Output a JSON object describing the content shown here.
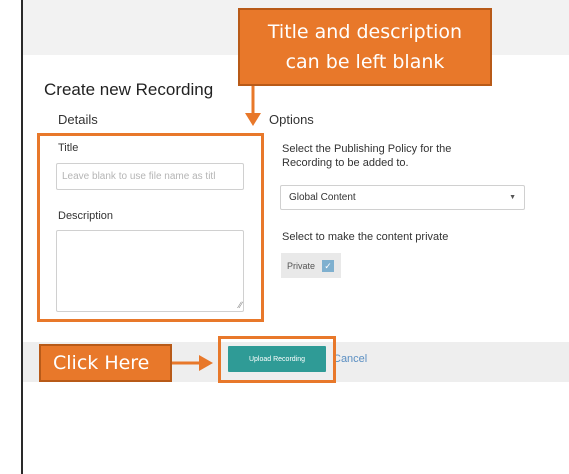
{
  "dialog": {
    "title": "Create new Recording",
    "details_heading": "Details",
    "options_heading": "Options",
    "title_label": "Title",
    "title_placeholder": "Leave blank to use file name as titl",
    "description_label": "Description",
    "description_value": "",
    "policy_text": "Select the Publishing Policy for the Recording to be added to.",
    "policy_selected": "Global Content",
    "private_prompt": "Select to make the content private",
    "private_label": "Private",
    "private_checked": true,
    "upload_button": "Upload Recording",
    "cancel_link": "Cancel"
  },
  "annotations": {
    "top_callout_line1": "Title and description",
    "top_callout_line2": "can be left blank",
    "click_callout": "Click Here"
  },
  "icons": {
    "checkbox": "checkmark-icon",
    "select_caret": "caret-down-icon",
    "textarea_grip": "resize-grip-icon"
  },
  "colors": {
    "annotation_orange": "#e8782a",
    "upload_button": "#2f9b96",
    "cancel_link": "#5b8fc2",
    "checkbox": "#7fb0cf"
  }
}
